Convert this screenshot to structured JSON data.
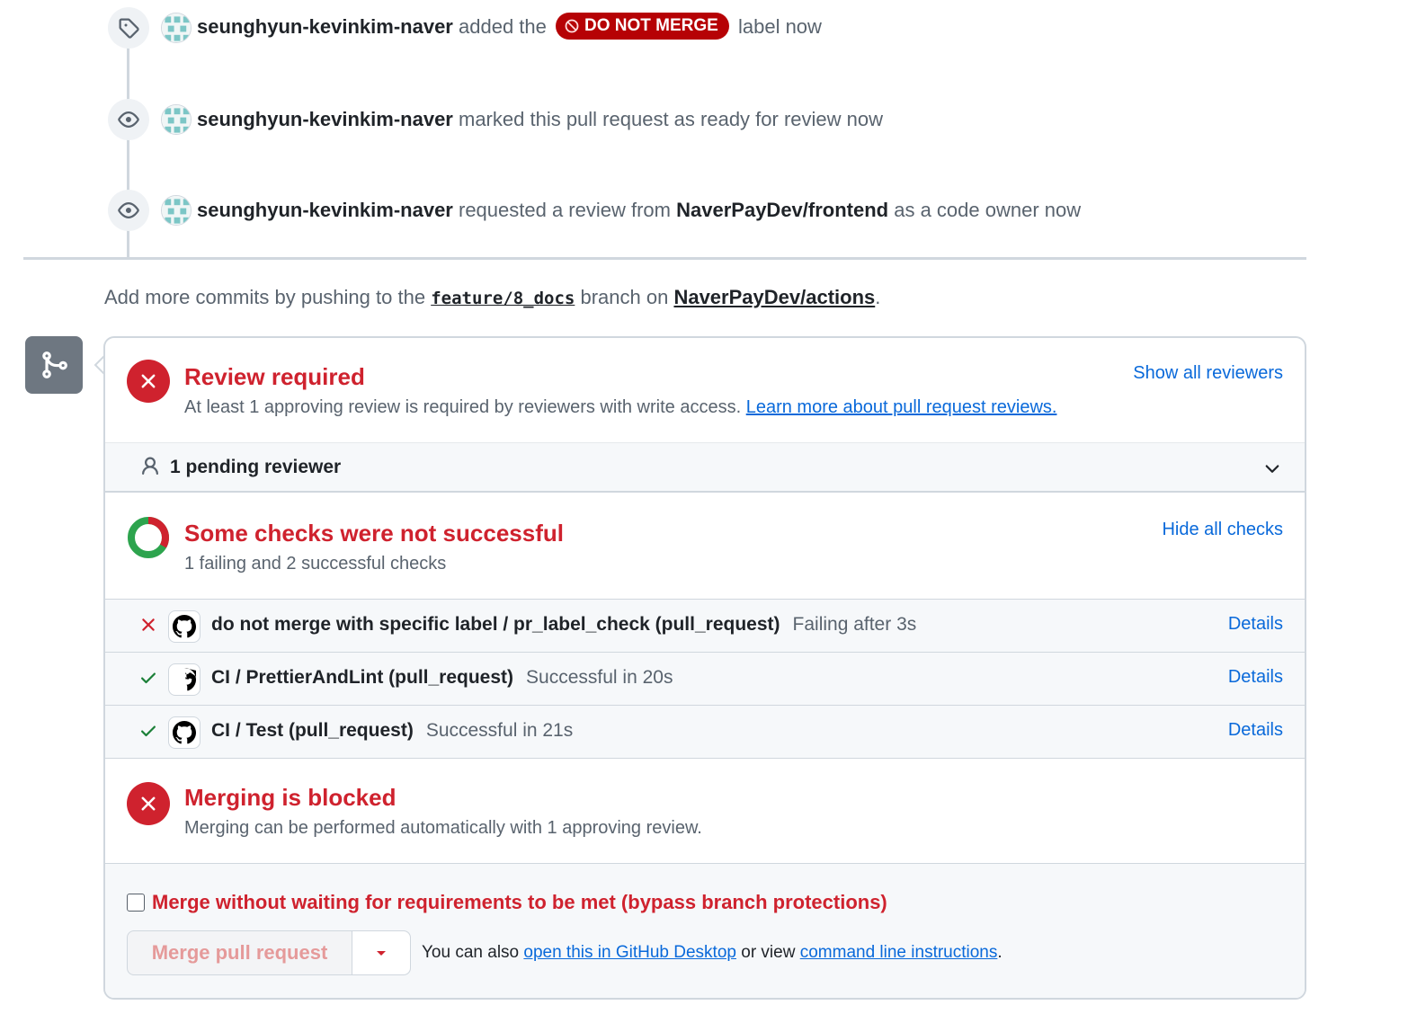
{
  "timeline": {
    "events": [
      {
        "icon": "tag-icon",
        "author": "seunghyun-kevinkim-naver",
        "text_before": "added the",
        "label": "DO NOT MERGE",
        "text_after": "label now"
      },
      {
        "icon": "eye-icon",
        "author": "seunghyun-kevinkim-naver",
        "text": "marked this pull request as ready for review now"
      },
      {
        "icon": "eye-icon",
        "author": "seunghyun-kevinkim-naver",
        "text_before": "requested a review from",
        "team": "NaverPayDev/frontend",
        "text_after": "as a code owner now"
      }
    ]
  },
  "push_hint": {
    "prefix": "Add more commits by pushing to the",
    "branch": "feature/8_docs",
    "middle": "branch on",
    "repo": "NaverPayDev/actions",
    "suffix": "."
  },
  "review": {
    "title": "Review required",
    "desc": "At least 1 approving review is required by reviewers with write access.",
    "learn_link": "Learn more about pull request reviews.",
    "show_reviewers": "Show all reviewers",
    "pending": "1 pending reviewer"
  },
  "checks": {
    "title": "Some checks were not successful",
    "summary": "1 failing and 2 successful checks",
    "hide_link": "Hide all checks",
    "items": [
      {
        "status": "fail",
        "name": "do not merge with specific label / pr_label_check (pull_request)",
        "meta": "Failing after 3s",
        "details": "Details"
      },
      {
        "status": "success",
        "name": "CI / PrettierAndLint (pull_request)",
        "meta": "Successful in 20s",
        "details": "Details"
      },
      {
        "status": "success",
        "name": "CI / Test (pull_request)",
        "meta": "Successful in 21s",
        "details": "Details"
      }
    ]
  },
  "merge": {
    "title": "Merging is blocked",
    "desc": "Merging can be performed automatically with 1 approving review.",
    "bypass_label": "Merge without waiting for requirements to be met (bypass branch protections)",
    "button": "Merge pull request",
    "alt_prefix": "You can also",
    "alt_desktop": "open this in GitHub Desktop",
    "alt_middle": "or view",
    "alt_cli": "command line instructions",
    "alt_suffix": "."
  },
  "colors": {
    "danger": "#cf222e",
    "success": "#1a7f37",
    "link": "#0969da",
    "label_bg": "#b60205"
  }
}
